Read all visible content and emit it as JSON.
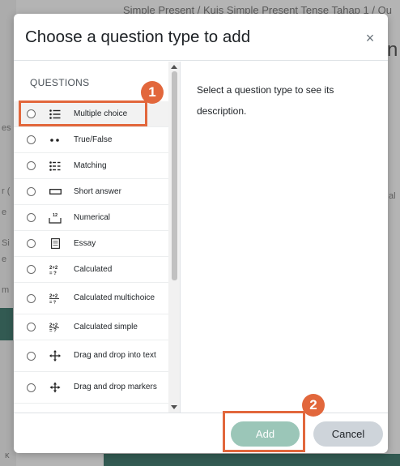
{
  "background": {
    "breadcrumb": "Simple Present / Kuis Simple Present Tense Tahap 1 / Qu",
    "fragments": [
      "n",
      "es",
      "r (",
      "e",
      "Si",
      "e",
      "m",
      "al",
      "κ"
    ]
  },
  "modal": {
    "title": "Choose a question type to add",
    "close_glyph": "×",
    "section_label": "QUESTIONS",
    "question_types": [
      {
        "label": "Multiple choice",
        "icon": "multiple-choice-icon"
      },
      {
        "label": "True/False",
        "icon": "true-false-icon"
      },
      {
        "label": "Matching",
        "icon": "matching-icon"
      },
      {
        "label": "Short answer",
        "icon": "short-answer-icon"
      },
      {
        "label": "Numerical",
        "icon": "numerical-icon"
      },
      {
        "label": "Essay",
        "icon": "essay-icon"
      },
      {
        "label": "Calculated",
        "icon": "calculated-icon"
      },
      {
        "label": "Calculated multichoice",
        "icon": "calculated-multichoice-icon"
      },
      {
        "label": "Calculated simple",
        "icon": "calculated-simple-icon"
      },
      {
        "label": "Drag and drop into text",
        "icon": "drag-drop-text-icon"
      },
      {
        "label": "Drag and drop markers",
        "icon": "drag-drop-markers-icon"
      }
    ],
    "description": "Select a question type to see its description.",
    "add_label": "Add",
    "cancel_label": "Cancel"
  },
  "annotations": {
    "step1": "1",
    "step2": "2"
  },
  "colors": {
    "accent": "#e2673c",
    "add_button": "#9bc6b8",
    "cancel_button": "#ced4da",
    "page_green": "#3e6e64"
  },
  "icons": {
    "numerical_glyph": "12",
    "calc_glyph_top": "2+2",
    "calc_glyph_bottom": "= ?"
  }
}
